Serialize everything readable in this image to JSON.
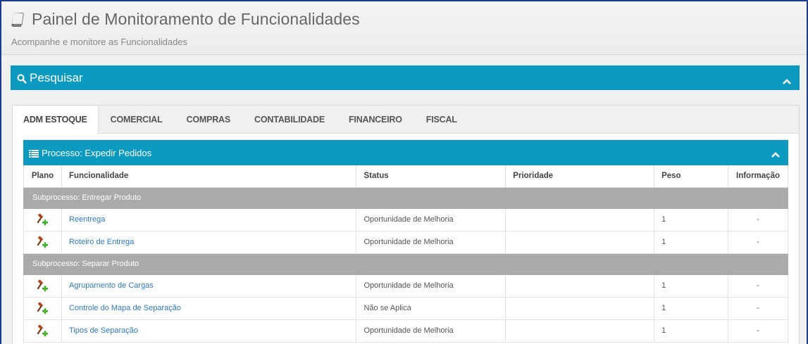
{
  "header": {
    "title": "Painel de Monitoramento de Funcionalidades",
    "subtitle": "Acompanhe e monitore as Funcionalidades"
  },
  "search": {
    "label": "Pesquisar"
  },
  "tabs": [
    {
      "label": "ADM ESTOQUE",
      "active": true
    },
    {
      "label": "COMERCIAL",
      "active": false
    },
    {
      "label": "COMPRAS",
      "active": false
    },
    {
      "label": "CONTABILIDADE",
      "active": false
    },
    {
      "label": "FINANCEIRO",
      "active": false
    },
    {
      "label": "FISCAL",
      "active": false
    }
  ],
  "process": {
    "label": "Processo: Expedir Pedidos"
  },
  "table": {
    "columns": [
      "Plano",
      "Funcionalidade",
      "Status",
      "Prioridade",
      "Peso",
      "Informação"
    ],
    "groups": [
      {
        "label": "Subprocesso: Entregar Produto",
        "rows": [
          {
            "funcionalidade": "Reentrega",
            "status": "Oportunidade de Melhoria",
            "prioridade": "",
            "peso": "1",
            "informacao": "-"
          },
          {
            "funcionalidade": "Roteiro de Entrega",
            "status": "Oportunidade de Melhoria",
            "prioridade": "",
            "peso": "1",
            "informacao": "-"
          }
        ]
      },
      {
        "label": "Subprocesso: Separar Produto",
        "rows": [
          {
            "funcionalidade": "Agrupamento de Cargas",
            "status": "Oportunidade de Melhoria",
            "prioridade": "",
            "peso": "1",
            "informacao": "-"
          },
          {
            "funcionalidade": "Controle do Mapa de Separação",
            "status": "Não se Aplica",
            "prioridade": "",
            "peso": "1",
            "informacao": "-"
          },
          {
            "funcionalidade": "Tipos de Separação",
            "status": "Oportunidade de Melhoria",
            "prioridade": "",
            "peso": "1",
            "informacao": "-"
          }
        ]
      }
    ]
  },
  "colors": {
    "accent": "#0d9ac0",
    "subprocess": "#aaaaaa",
    "link": "#2a7ac8"
  }
}
